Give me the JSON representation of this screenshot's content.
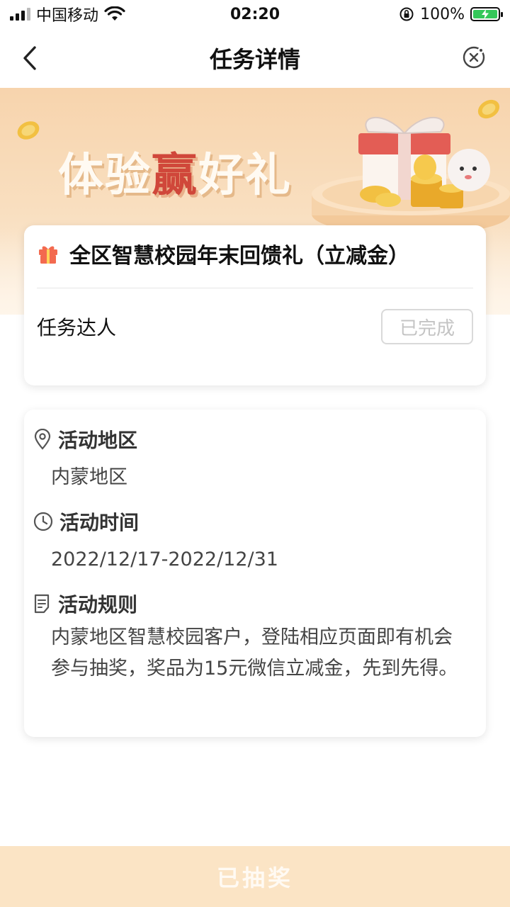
{
  "status_bar": {
    "carrier": "中国移动",
    "time": "02:20",
    "battery": "100%"
  },
  "nav": {
    "title": "任务详情"
  },
  "banner": {
    "slogan_part1": "体验",
    "slogan_accent": "赢",
    "slogan_part2": "好礼"
  },
  "task_card": {
    "title": "全区智慧校园年末回馈礼（立减金）",
    "task_name": "任务达人",
    "status": "已完成"
  },
  "info_card": {
    "region_label": "活动地区",
    "region_value": "内蒙地区",
    "time_label": "活动时间",
    "time_value": "2022/12/17-2022/12/31",
    "rules_label": "活动规则",
    "rules_value": "内蒙地区智慧校园客户，登陆相应页面即有机会参与抽奖，奖品为15元微信立减金，先到先得。"
  },
  "bottom_button": {
    "label": "已抽奖"
  },
  "colors": {
    "accent_red": "#d0473a",
    "banner_bg": "#f7d4ad",
    "bottom_bar": "#fbe4c5"
  }
}
